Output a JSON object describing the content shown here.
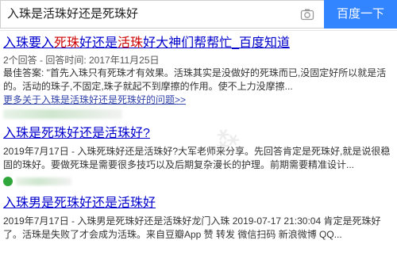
{
  "search": {
    "query": "入珠是活珠好还是死珠好",
    "button_label": "百度一下"
  },
  "results": [
    {
      "title_parts": [
        "入珠要入",
        "死珠",
        "好还是",
        "活珠",
        "好大神们帮帮忙_百度知道"
      ],
      "meta": "2个回答 - 回答时间: 2017年11月25日",
      "snippet_1": "最佳答案: \"首先入珠只有死珠才有效果。活珠其实是没做好的死珠而已,没固定好所以就是活的。活动的珠子,不固定,珠子就起不到摩擦的作用。使不上力没摩擦...",
      "more": "更多关于入珠是活珠好还是死珠好的问题>>"
    },
    {
      "title": "入珠是死珠好还是活珠好?",
      "snippet_1": "2019年7月17日 - 入珠死珠好还是活珠好?大军老师来分享。先回答肯定是死珠好,就是说很稳固的珠好。要做死珠是需要很多技巧以及后期复杂漫长的护理。前期需要精准设计..."
    },
    {
      "title": "入珠男是死珠好还是活珠好",
      "snippet_1": "2019年7月17日 - 入珠男是死珠好还是活珠好龙门入珠 2019-07-17 21:30:04 肯定是死珠好了。活珠是失败了才会成为活珠。来自豆瓣App 赞 转发 微信扫码 新浪微博 QQ..."
    }
  ]
}
